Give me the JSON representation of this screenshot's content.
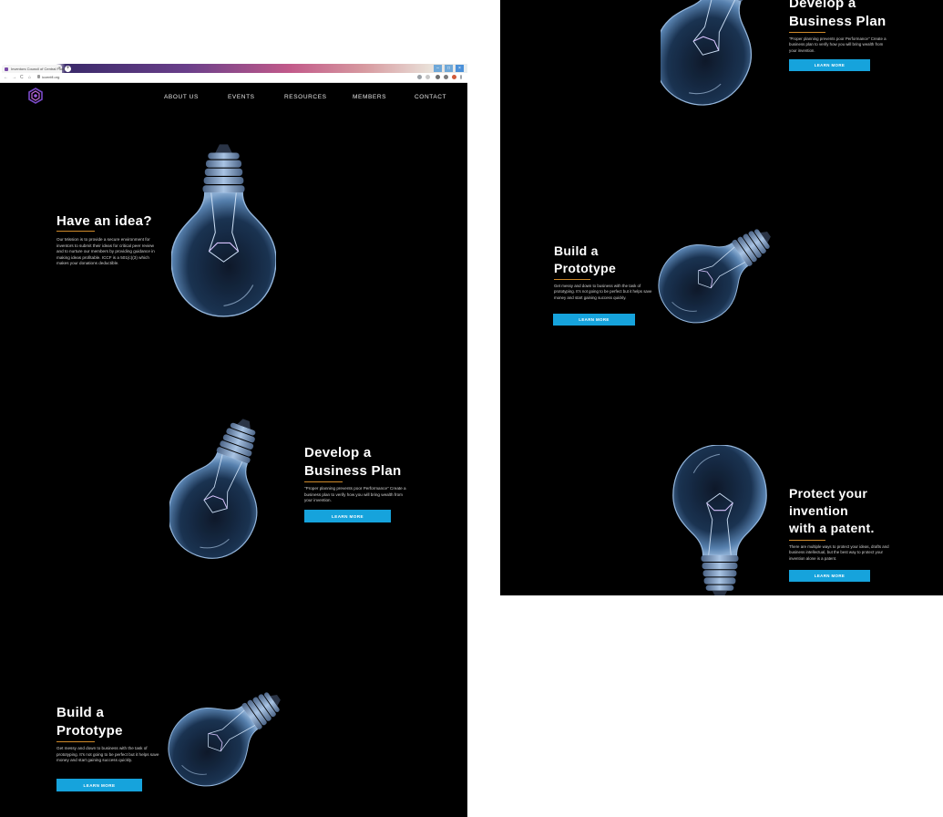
{
  "browser": {
    "tab_title": "Inventors Council of Central Florida",
    "tab_close": "×",
    "new_tab": "+",
    "url": "iccentfl.org",
    "back": "←",
    "forward": "→",
    "reload": "C",
    "home": "⌂",
    "minimize": "–",
    "maximize": "□",
    "close": "×"
  },
  "nav": {
    "items": [
      "ABOUT US",
      "EVENTS",
      "RESOURCES",
      "MEMBERS",
      "CONTACT"
    ]
  },
  "hero": {
    "title": "Have an idea?",
    "body": "Our Mission is to provide a secure environment for inventors to submit their ideas for critical peer review and to nurture our members by providing guidance in making ideas profitable. ICCF is a 501(c)(3) which makes your donations deductible."
  },
  "business_plan": {
    "title_line1": "Develop a",
    "title_line2": "Business Plan",
    "body": "\"Proper planning prevents poor Performance\" Create a business plan to verify how you will bring wealth from your invention.",
    "button": "LEARN MORE"
  },
  "prototype": {
    "title_line1": "Build a",
    "title_line2": "Prototype",
    "body": "Get messy and down to business with the task of prototyping. It's not going to be perfect but it helps save money and start gaining success quickly.",
    "button": "LEARN MORE"
  },
  "patent": {
    "title_line1": "Protect your",
    "title_line2": "invention",
    "title_line3": "with a patent.",
    "body": "There are multiple ways to protect your ideas, drafts and business intellectual, but the best way to protect your invention alone is a patent.",
    "button": "LEARN MORE"
  },
  "icons": {
    "logo": "iccf-logo-icon",
    "bulb": "light-bulb-icon"
  },
  "colors": {
    "background": "#000000",
    "accent_button": "#16a3dc",
    "accent_rule": "#d08a2a",
    "text": "#ffffff"
  }
}
